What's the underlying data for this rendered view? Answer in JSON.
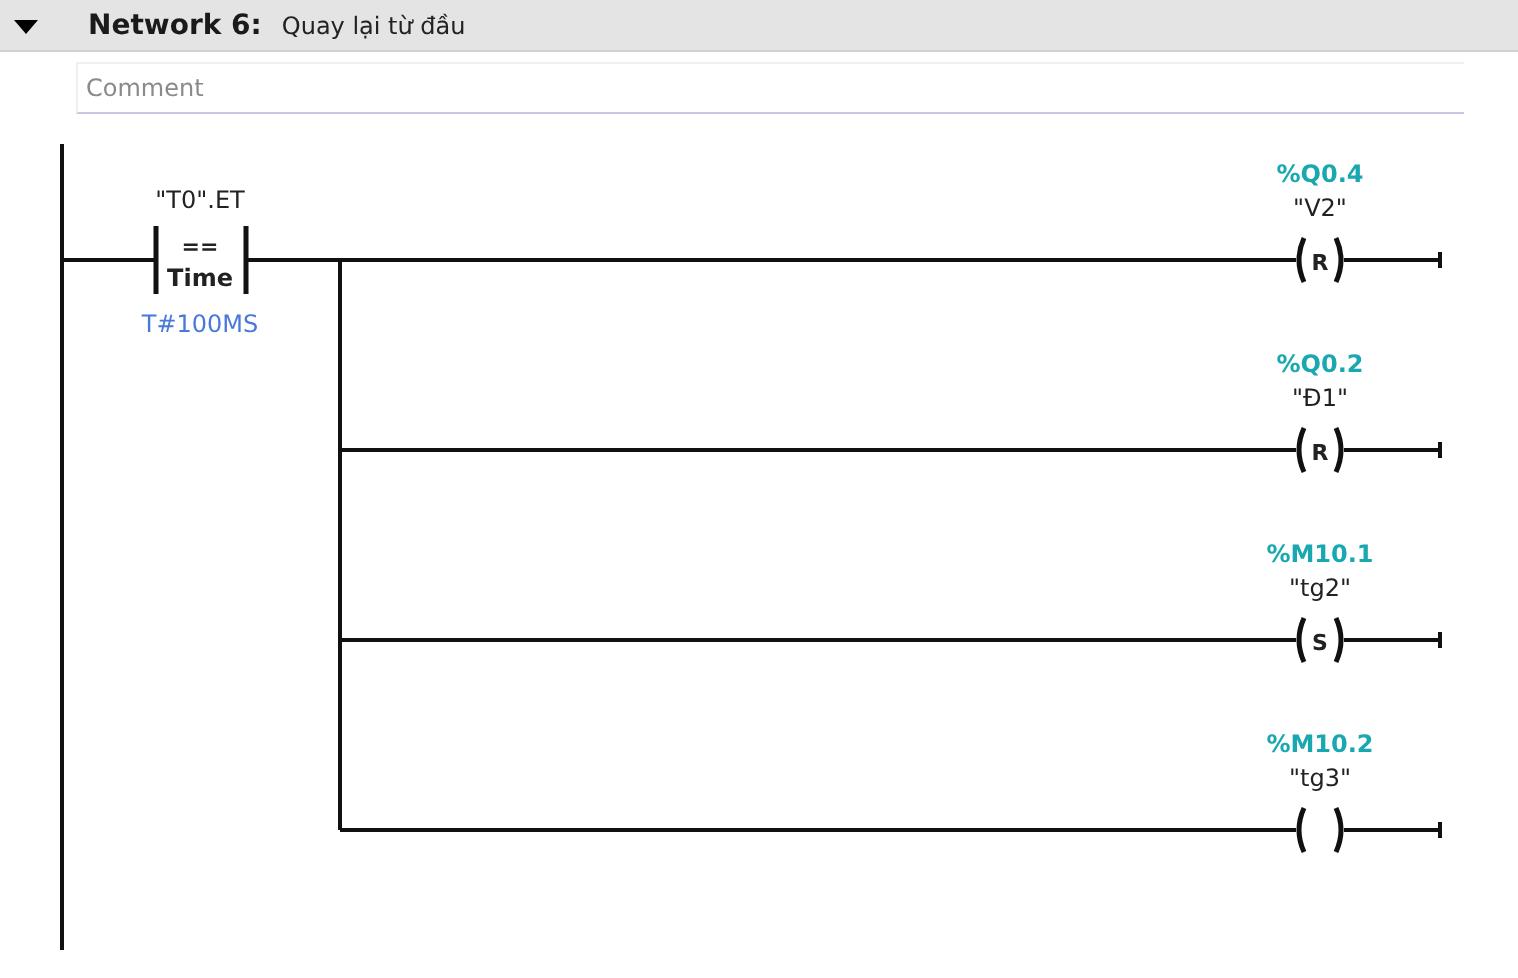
{
  "network": {
    "expanded": true,
    "label": "Network 6:",
    "title": "Quay lại từ đầu"
  },
  "comment": {
    "placeholder": "Comment"
  },
  "contact": {
    "operand": "\"T0\".ET",
    "operator": "==",
    "type": "Time",
    "value": "T#100MS"
  },
  "coils": [
    {
      "address": "%Q0.4",
      "operand": "\"V2\"",
      "letter": "R"
    },
    {
      "address": "%Q0.2",
      "operand": "\"Đ1\"",
      "letter": "R"
    },
    {
      "address": "%M10.1",
      "operand": "\"tg2\"",
      "letter": "S"
    },
    {
      "address": "%M10.2",
      "operand": "\"tg3\""
    }
  ]
}
